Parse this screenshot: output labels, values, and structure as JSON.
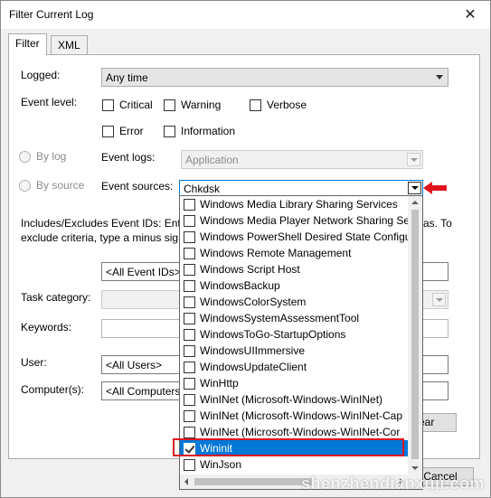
{
  "window": {
    "title": "Filter Current Log",
    "close_glyph": "✕"
  },
  "tabs": [
    {
      "label": "Filter"
    },
    {
      "label": "XML"
    }
  ],
  "filter": {
    "logged_label": "Logged:",
    "logged_value": "Any time",
    "event_level_label": "Event level:",
    "levels": [
      {
        "label": "Critical",
        "checked": false
      },
      {
        "label": "Warning",
        "checked": false
      },
      {
        "label": "Verbose",
        "checked": false
      },
      {
        "label": "Error",
        "checked": false
      },
      {
        "label": "Information",
        "checked": false
      }
    ],
    "by_log_label": "By log",
    "by_source_label": "By source",
    "event_logs_label": "Event logs:",
    "event_logs_value": "Application",
    "event_sources_label": "Event sources:",
    "event_sources_value": "Chkdsk",
    "includes_line1_left": "Includes/Excludes Event IDs: Ente",
    "includes_line1_right": "as. To",
    "includes_line2_left": "exclude criteria, type a minus sign",
    "event_ids_value": "<All Event IDs>",
    "task_category_label": "Task category:",
    "keywords_label": "Keywords:",
    "user_label": "User:",
    "user_value": "<All Users>",
    "computers_label": "Computer(s):",
    "computers_value": "<All Computers",
    "clear_label": "ear",
    "cancel_label": "Cancel"
  },
  "dropdown": {
    "items": [
      {
        "label": "Windows Media Library Sharing Services",
        "checked": false
      },
      {
        "label": "Windows Media Player Network Sharing Se",
        "checked": false
      },
      {
        "label": "Windows PowerShell Desired State Configu",
        "checked": false
      },
      {
        "label": "Windows Remote Management",
        "checked": false
      },
      {
        "label": "Windows Script Host",
        "checked": false
      },
      {
        "label": "WindowsBackup",
        "checked": false
      },
      {
        "label": "WindowsColorSystem",
        "checked": false
      },
      {
        "label": "WindowsSystemAssessmentTool",
        "checked": false
      },
      {
        "label": "WindowsToGo-StartupOptions",
        "checked": false
      },
      {
        "label": "WindowsUIImmersive",
        "checked": false
      },
      {
        "label": "WindowsUpdateClient",
        "checked": false
      },
      {
        "label": "WinHttp",
        "checked": false
      },
      {
        "label": "WinINet (Microsoft-Windows-WinINet)",
        "checked": false
      },
      {
        "label": "WinINet (Microsoft-Windows-WinINet-Cap",
        "checked": false
      },
      {
        "label": "WinINet (Microsoft-Windows-WinINet-Cor",
        "checked": false
      },
      {
        "label": "Wininit",
        "checked": true,
        "selected": true
      },
      {
        "label": "WinJson",
        "checked": false
      }
    ]
  },
  "colors": {
    "selection": "#0078d7",
    "highlight_border": "#e0141e",
    "pointer_arrow": "#e0141e"
  },
  "watermark": "shenzhendianxuji.com"
}
